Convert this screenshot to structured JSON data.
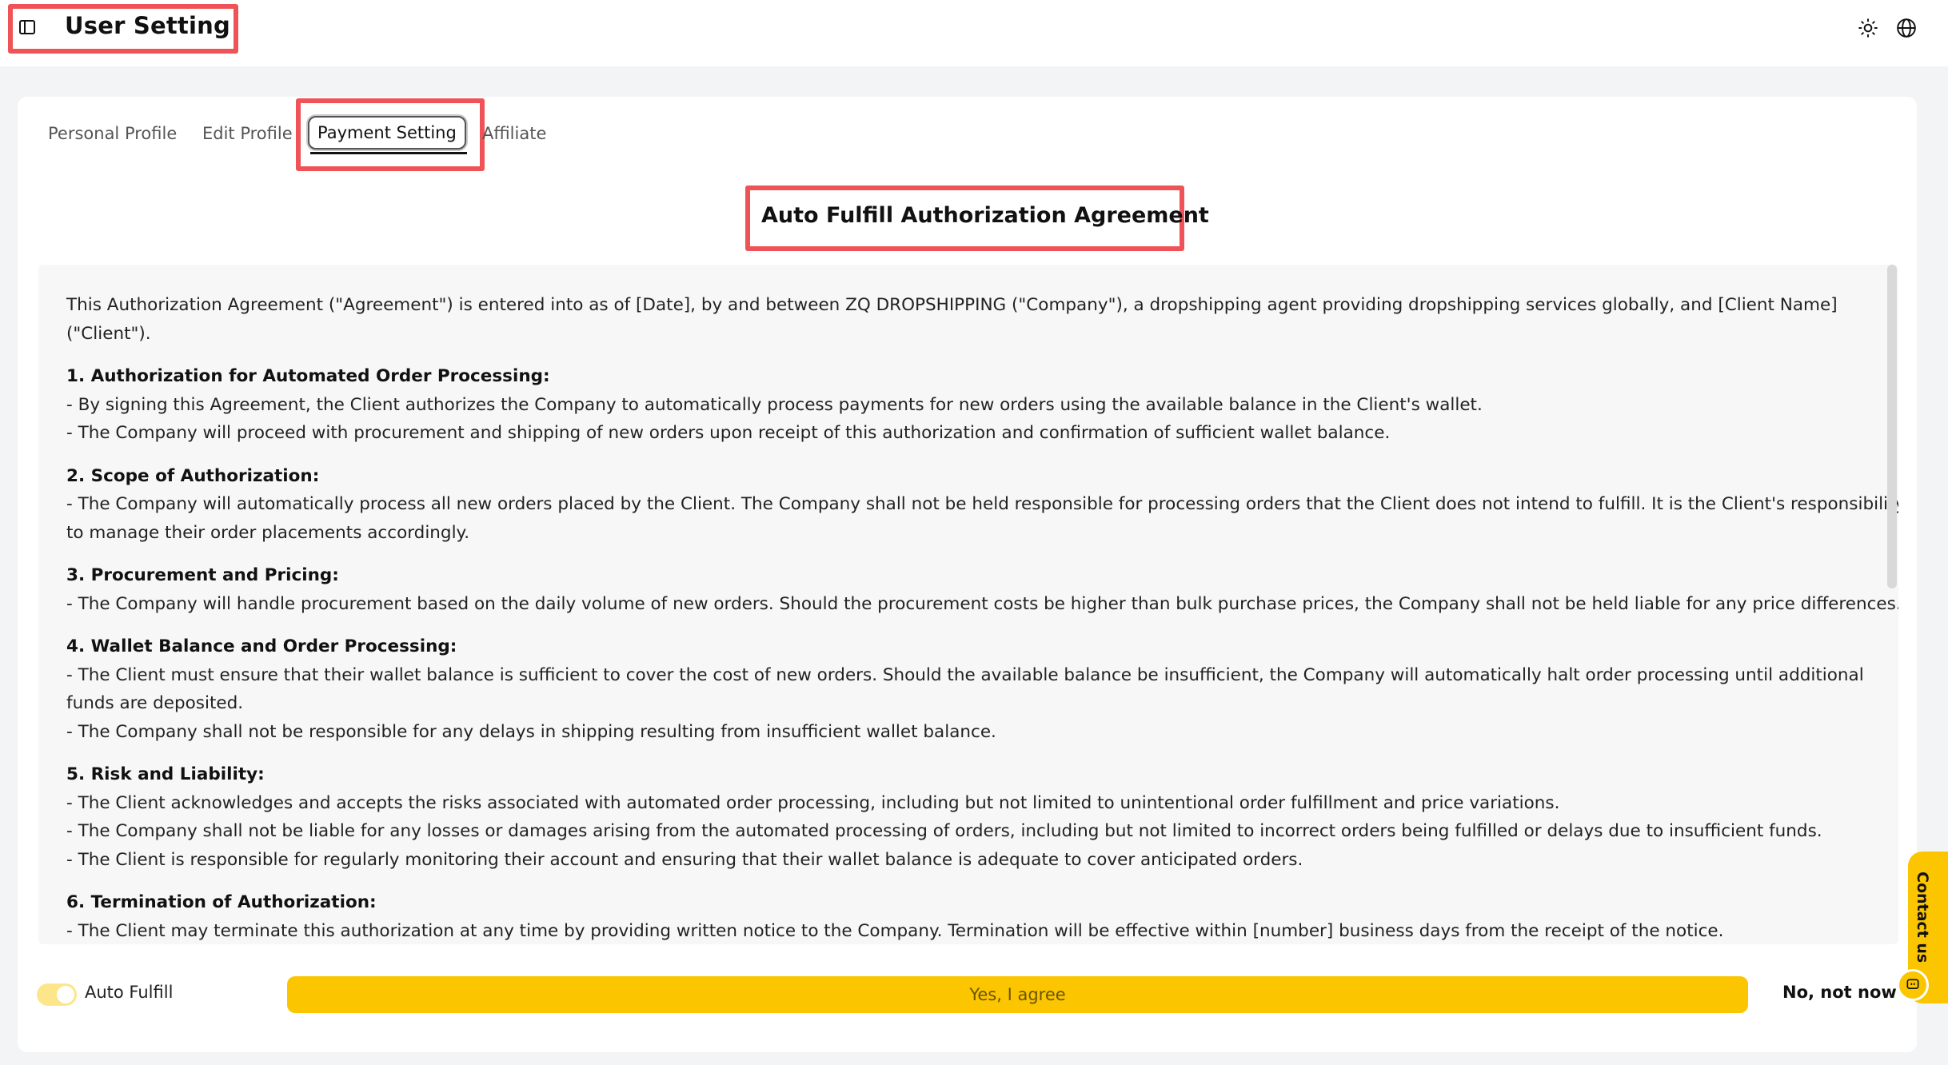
{
  "header": {
    "title": "User Setting",
    "icons": [
      "sidebar-toggle-icon",
      "sun-icon",
      "globe-icon"
    ]
  },
  "tabs": [
    {
      "label": "Personal Profile",
      "active": false
    },
    {
      "label": "Edit Profile",
      "active": false
    },
    {
      "label": "Payment Setting",
      "active": true
    },
    {
      "label": "Affiliate",
      "active": false
    }
  ],
  "agreement": {
    "title": "Auto Fulfill Authorization Agreement",
    "intro": "This Authorization Agreement (\"Agreement\") is entered into as of [Date], by and between ZQ DROPSHIPPING (\"Company\"), a dropshipping agent providing dropshipping services globally, and [Client Name] (\"Client\").",
    "sections": [
      {
        "heading": "1. Authorization for Automated Order Processing:",
        "lines": [
          "- By signing this Agreement, the Client authorizes the Company to automatically process payments for new orders using the available balance in the Client's wallet.",
          "- The Company will proceed with procurement and shipping of new orders upon receipt of this authorization and confirmation of sufficient wallet balance."
        ]
      },
      {
        "heading": "2. Scope of Authorization:",
        "lines": [
          "- The Company will automatically process all new orders placed by the Client. The Company shall not be held responsible for processing orders that the Client does not intend to fulfill. It is the Client's responsibility to manage their order placements accordingly."
        ]
      },
      {
        "heading": "3. Procurement and Pricing:",
        "lines": [
          "- The Company will handle procurement based on the daily volume of new orders. Should the procurement costs be higher than bulk purchase prices, the Company shall not be held liable for any price differences."
        ]
      },
      {
        "heading": "4. Wallet Balance and Order Processing:",
        "lines": [
          "- The Client must ensure that their wallet balance is sufficient to cover the cost of new orders. Should the available balance be insufficient, the Company will automatically halt order processing until additional funds are deposited.",
          "- The Company shall not be responsible for any delays in shipping resulting from insufficient wallet balance."
        ]
      },
      {
        "heading": "5. Risk and Liability:",
        "lines": [
          "- The Client acknowledges and accepts the risks associated with automated order processing, including but not limited to unintentional order fulfillment and price variations.",
          "- The Company shall not be liable for any losses or damages arising from the automated processing of orders, including but not limited to incorrect orders being fulfilled or delays due to insufficient funds.",
          "- The Client is responsible for regularly monitoring their account and ensuring that their wallet balance is adequate to cover anticipated orders."
        ]
      },
      {
        "heading": "6. Termination of Authorization:",
        "lines": [
          "- The Client may terminate this authorization at any time by providing written notice to the Company. Termination will be effective within [number] business days from the receipt of the notice."
        ]
      }
    ]
  },
  "footer": {
    "toggle_label": "Auto Fulfill",
    "toggle_on": true,
    "agree_label": "Yes, I agree",
    "decline_label": "No, not now"
  },
  "contact": {
    "label": "Contact us"
  },
  "colors": {
    "accent": "#fbc500",
    "highlight_box": "#ef5358",
    "toggle_track": "#fde68a"
  }
}
